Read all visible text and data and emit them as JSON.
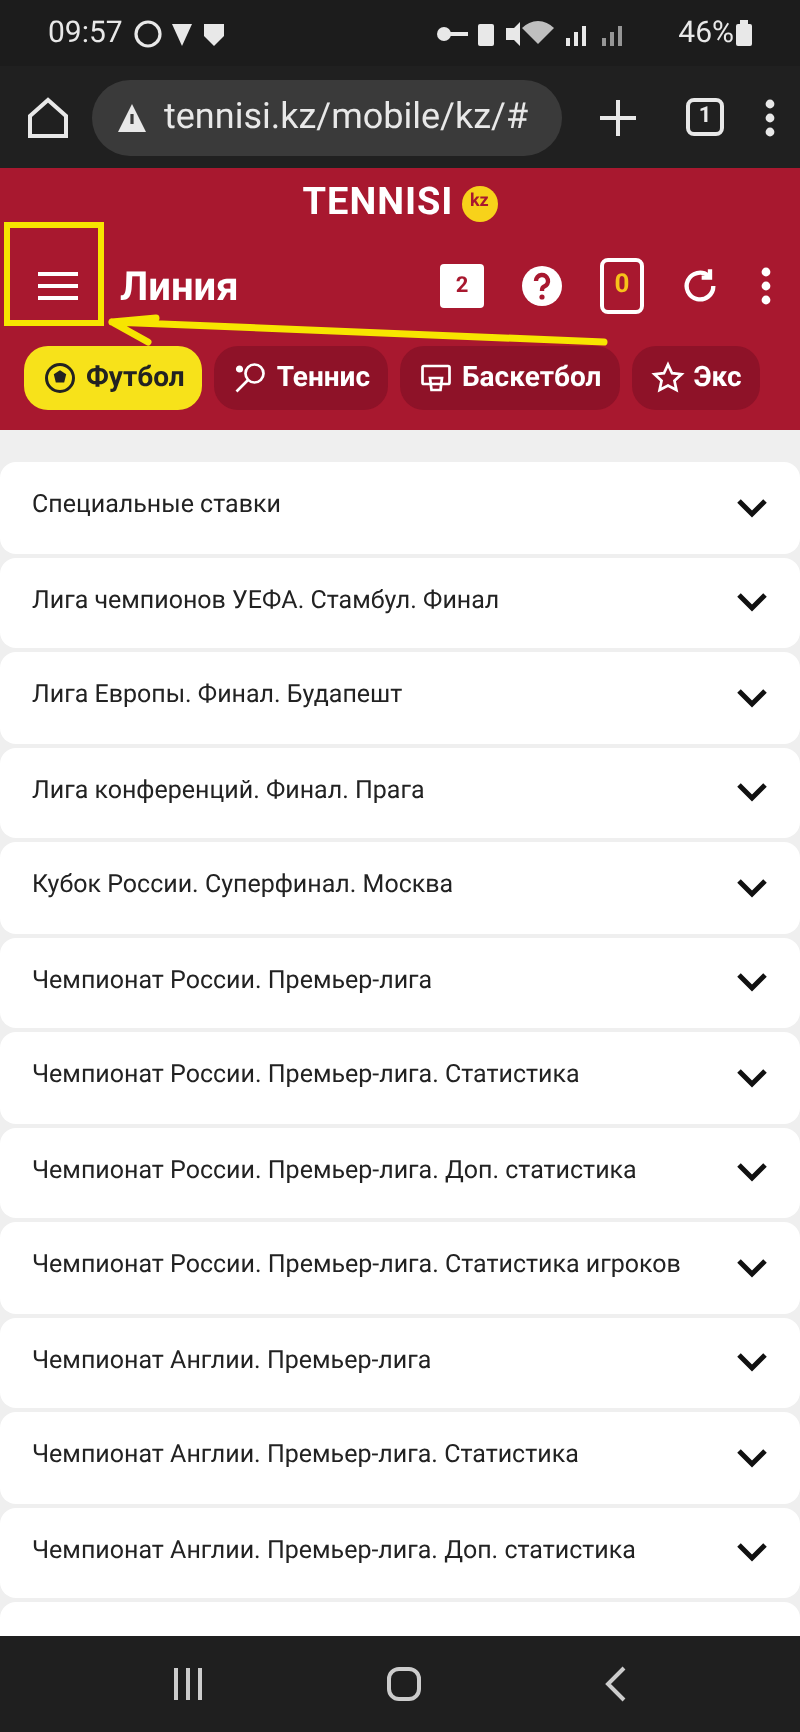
{
  "status_bar": {
    "time": "09:57",
    "battery": "46%"
  },
  "browser": {
    "url": "tennisi.kz/mobile/kz/#",
    "tab_count": "1"
  },
  "header": {
    "logo": "TENNISI",
    "logo_badge": "kz",
    "title": "Линия",
    "messages_count": "2",
    "coupon_count": "0"
  },
  "sports": [
    {
      "label": "Футбол",
      "selected": true,
      "kind": "ball"
    },
    {
      "label": "Теннис",
      "selected": false,
      "kind": "racket"
    },
    {
      "label": "Баскетбол",
      "selected": false,
      "kind": "hoop"
    },
    {
      "label": "Экс",
      "selected": false,
      "kind": "star"
    }
  ],
  "leagues": [
    {
      "name": "Специальные ставки"
    },
    {
      "name": "Лига чемпионов УЕФА. Стамбул. Финал"
    },
    {
      "name": "Лига Европы. Финал. Будапешт"
    },
    {
      "name": "Лига конференций. Финал. Прага"
    },
    {
      "name": "Кубок России. Суперфинал. Москва"
    },
    {
      "name": "Чемпионат России. Премьер-лига"
    },
    {
      "name": "Чемпионат России. Премьер-лига. Статистика"
    },
    {
      "name": "Чемпионат России. Премьер-лига. Доп. статистика"
    },
    {
      "name": "Чемпионат России. Премьер-лига. Статистика игроков"
    },
    {
      "name": "Чемпионат Англии. Премьер-лига"
    },
    {
      "name": "Чемпионат Англии. Премьер-лига. Статистика"
    },
    {
      "name": "Чемпионат Англии. Премьер-лига. Доп. статистика"
    }
  ]
}
